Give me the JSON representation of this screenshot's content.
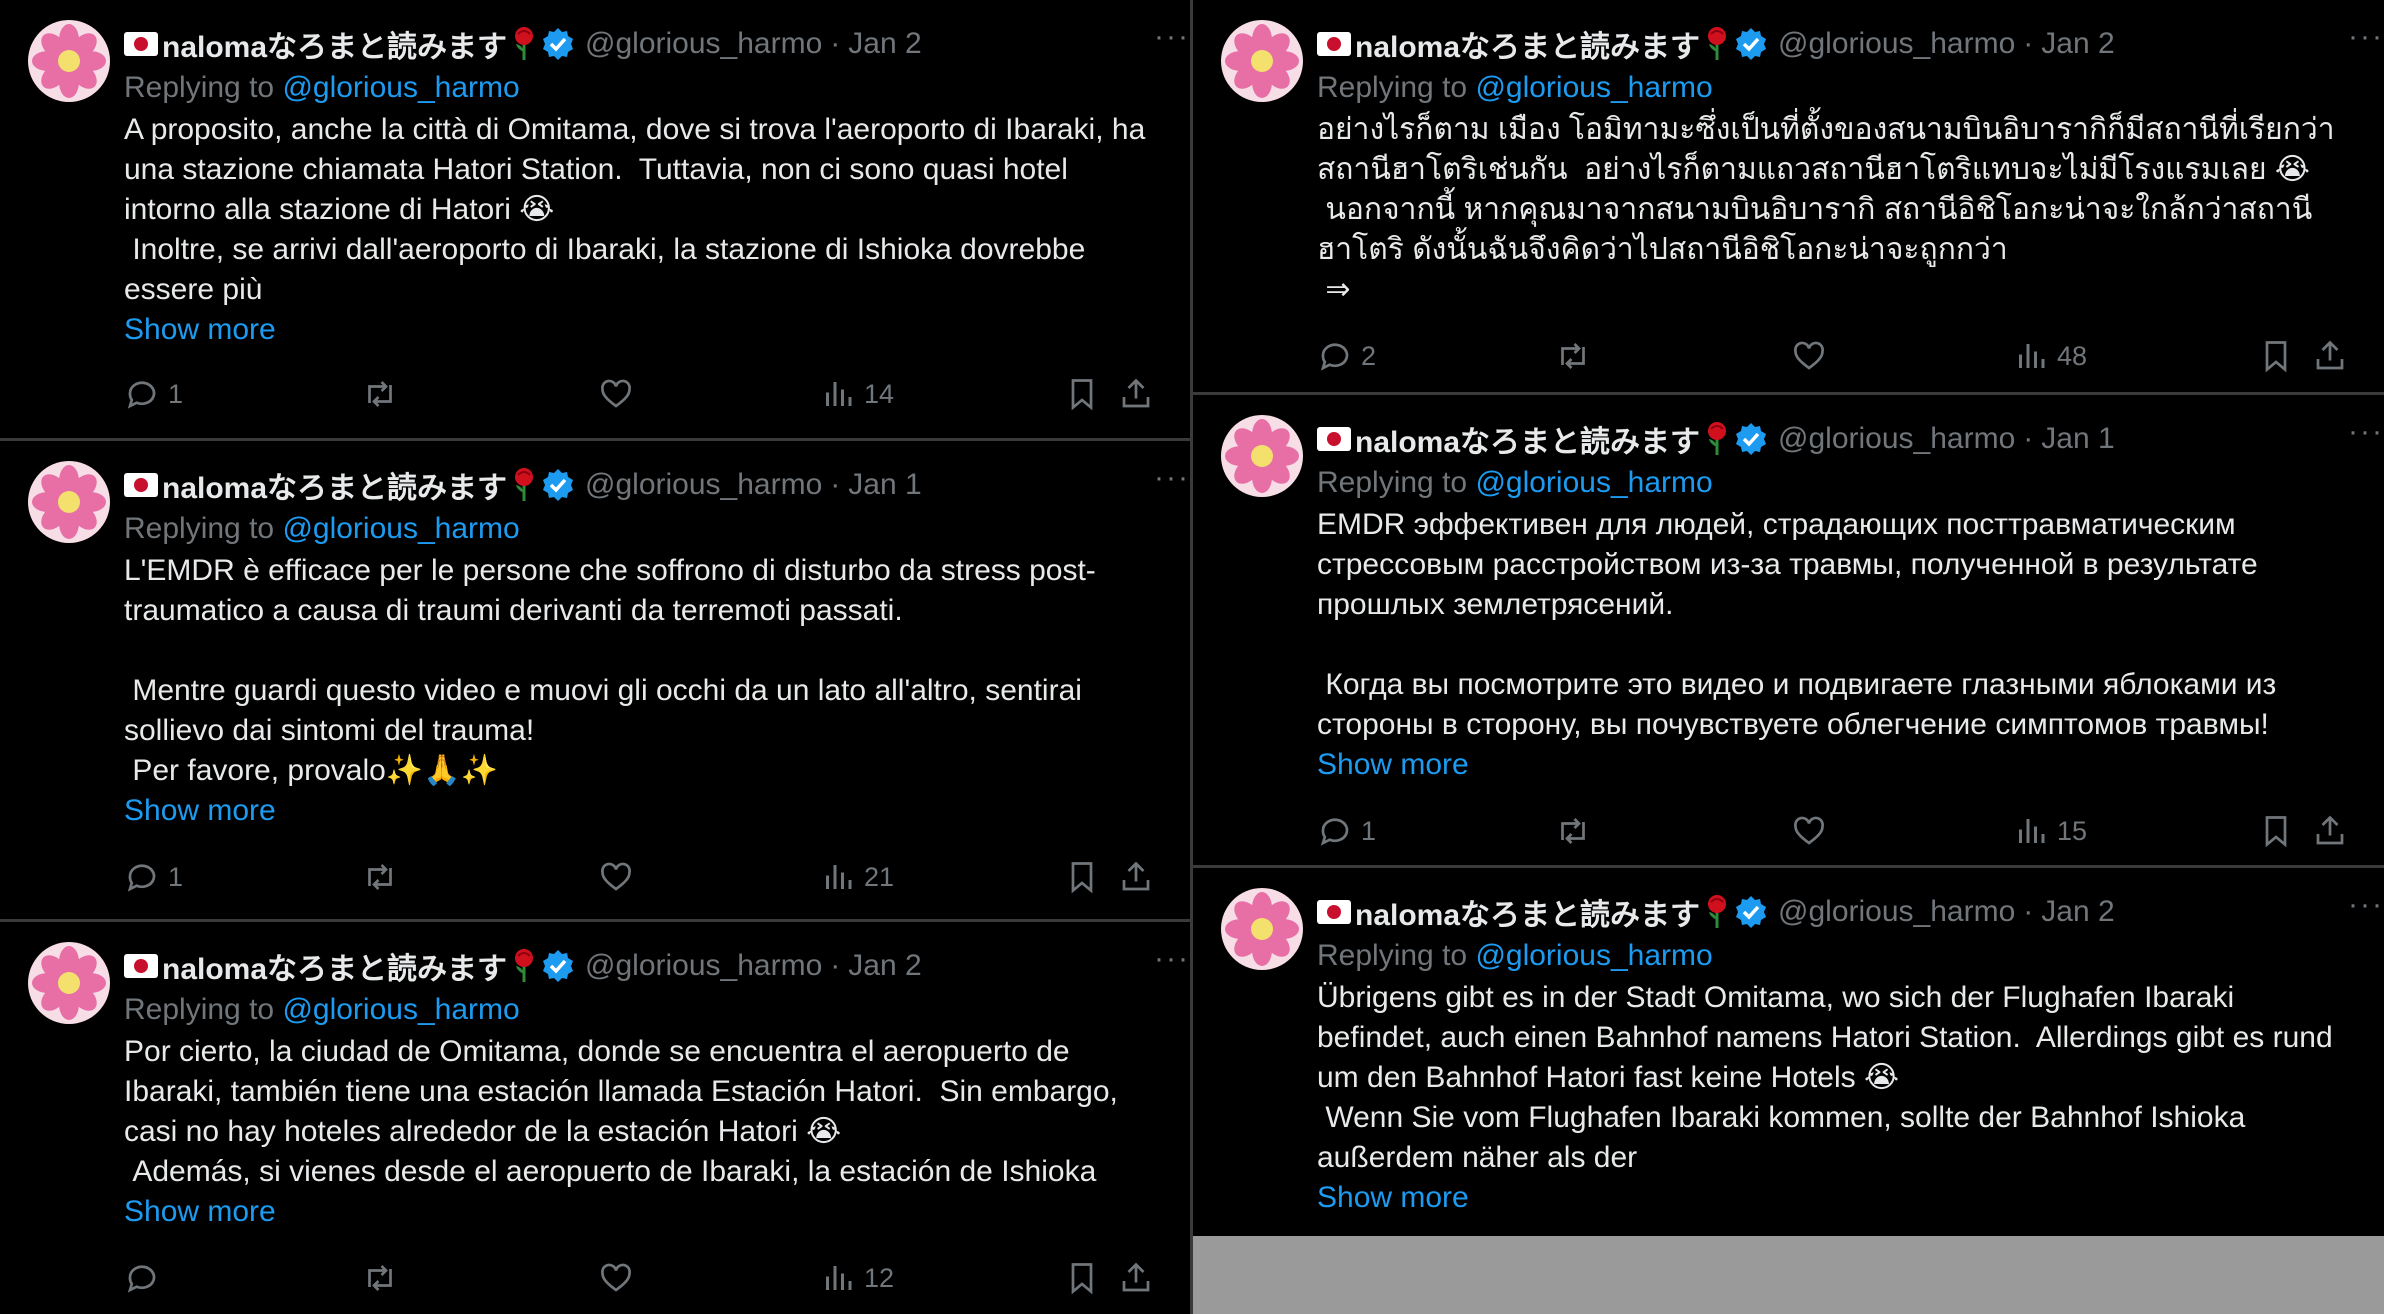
{
  "author": {
    "name": "nalomaなろまと読みます",
    "handle": "@glorious_harmo",
    "replying_prefix": "Replying to",
    "replying_handle": "@glorious_harmo"
  },
  "show_more_label": "Show more",
  "colors": {
    "background": "#000000",
    "text": "#e7e9ea",
    "muted": "#71767b",
    "link": "#1d9bf0",
    "separator": "#3a3a3a",
    "filler": "#9a9a9a"
  },
  "icons": [
    "flag-japan-icon",
    "rose-icon",
    "verified-badge-icon",
    "more-options-icon",
    "reply-icon",
    "retweet-icon",
    "like-icon",
    "views-icon",
    "bookmark-icon",
    "share-icon"
  ],
  "tweets": [
    {
      "date": "Jan 2",
      "text": "A proposito, anche la città di Omitama, dove si trova l'aeroporto di Ibaraki, ha una stazione chiamata Hatori Station.  Tuttavia, non ci sono quasi hotel intorno alla stazione di Hatori 😭\n Inoltre, se arrivi dall'aeroporto di Ibaraki, la stazione di Ishioka dovrebbe essere più",
      "replies": "1",
      "views": "14",
      "show_more": true
    },
    {
      "date": "Jan 1",
      "text": "L'EMDR è efficace per le persone che soffrono di disturbo da stress post-traumatico a causa di traumi derivanti da terremoti passati.\n\n Mentre guardi questo video e muovi gli occhi da un lato all'altro, sentirai sollievo dai sintomi del trauma!\n Per favore, provalo✨🙏✨",
      "replies": "1",
      "views": "21",
      "show_more": true
    },
    {
      "date": "Jan 2",
      "text": "Por cierto, la ciudad de Omitama, donde se encuentra el aeropuerto de Ibaraki, también tiene una estación llamada Estación Hatori.  Sin embargo, casi no hay hoteles alrededor de la estación Hatori 😭\n Además, si vienes desde el aeropuerto de Ibaraki, la estación de Ishioka",
      "replies": "",
      "views": "12",
      "show_more": true
    },
    {
      "date": "Jan 2",
      "text": "อย่างไรก็ตาม เมือง โอมิทามะซึ่งเป็นที่ตั้งของสนามบินอิบารากิก็มีสถานีที่เรียกว่าสถานีฮาโตริเช่นกัน  อย่างไรก็ตามแถวสถานีฮาโตริแทบจะไม่มีโรงแรมเลย 😭\n นอกจากนี้ หากคุณมาจากสนามบินอิบารากิ สถานีอิชิโอกะน่าจะใกล้กว่าสถานีฮาโตริ ดังนั้นฉันจึงคิดว่าไปสถานีอิชิโอกะน่าจะถูกกว่า\n ⇒",
      "replies": "2",
      "views": "48",
      "show_more": false
    },
    {
      "date": "Jan 1",
      "text": "EMDR эффективен для людей, страдающих посттравматическим стрессовым расстройством из-за травмы, полученной в результате прошлых землетрясений.\n\n Когда вы посмотрите это видео и подвигаете глазными яблоками из стороны в сторону, вы почувствуете облегчение симптомов травмы!",
      "replies": "1",
      "views": "15",
      "show_more": true
    },
    {
      "date": "Jan 2",
      "text": "Übrigens gibt es in der Stadt Omitama, wo sich der Flughafen Ibaraki befindet, auch einen Bahnhof namens Hatori Station.  Allerdings gibt es rund um den Bahnhof Hatori fast keine Hotels 😭\n Wenn Sie vom Flughafen Ibaraki kommen, sollte der Bahnhof Ishioka außerdem näher als der",
      "replies": "",
      "views": "",
      "show_more": true
    }
  ]
}
